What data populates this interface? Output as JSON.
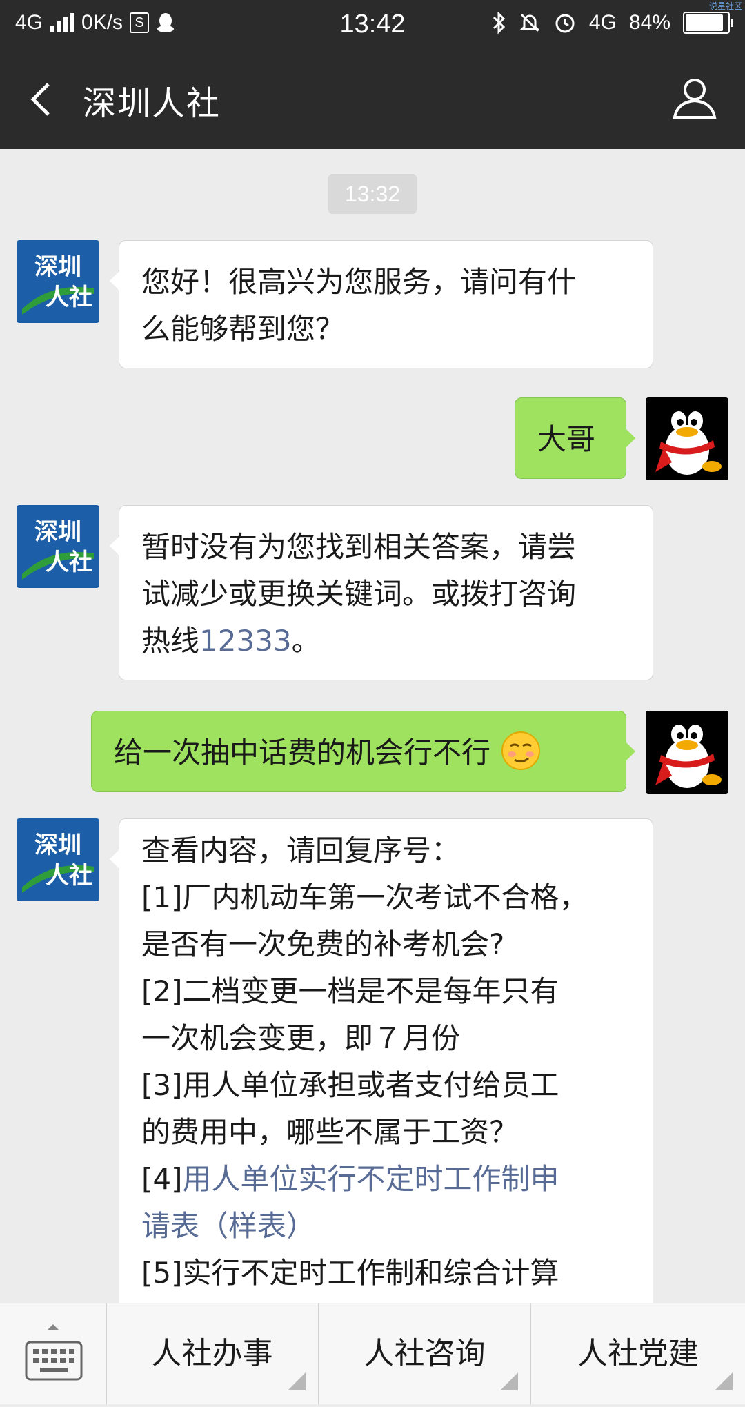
{
  "status_bar": {
    "network_left": "4G",
    "speed": "0K/s",
    "sim_icon_text": "S",
    "time": "13:42",
    "network_right": "4G",
    "battery": "84%",
    "watermark": "说星社区"
  },
  "header": {
    "title": "深圳人社"
  },
  "chat": {
    "timestamp": "13:32",
    "messages": [
      {
        "from": "bot",
        "lines": [
          "您好！很高兴为您服务，请问有什",
          "么能够帮到您？"
        ]
      },
      {
        "from": "user",
        "text": "大哥"
      },
      {
        "from": "bot",
        "lines": [
          "暂时没有为您找到相关答案，请尝",
          "试减少或更换关键词。或拨打咨询"
        ],
        "line3_prefix": "热线",
        "hotline": "12333",
        "line3_suffix": "。"
      },
      {
        "from": "user",
        "text": "给一次抽中话费的机会行不行"
      },
      {
        "from": "bot",
        "lines": [
          "查看内容，请回复序号：",
          "[1]厂内机动车第一次考试不合格，",
          "是否有一次免费的补考机会?",
          "[2]二档变更一档是不是每年只有",
          "一次机会变更，即７月份",
          "[3]用人单位承担或者支付给员工",
          "的费用中，哪些不属于工资？"
        ],
        "item4_prefix": "[4]",
        "item4_link_line1": "用人单位实行不定时工作制申",
        "item4_link_line2": "请表（样表）",
        "item5_partial": "[5]实行不定时工作制和综合计算"
      }
    ],
    "bot_avatar": {
      "line1": "深圳",
      "line2": "人社"
    }
  },
  "bottom_menu": {
    "items": [
      "人社办事",
      "人社咨询",
      "人社党建"
    ]
  },
  "colors": {
    "header_bg": "#2b2b2b",
    "chat_bg": "#ececec",
    "out_bubble": "#9fe25f",
    "link": "#576b95",
    "bot_avatar_bg": "#1c5fa8"
  }
}
